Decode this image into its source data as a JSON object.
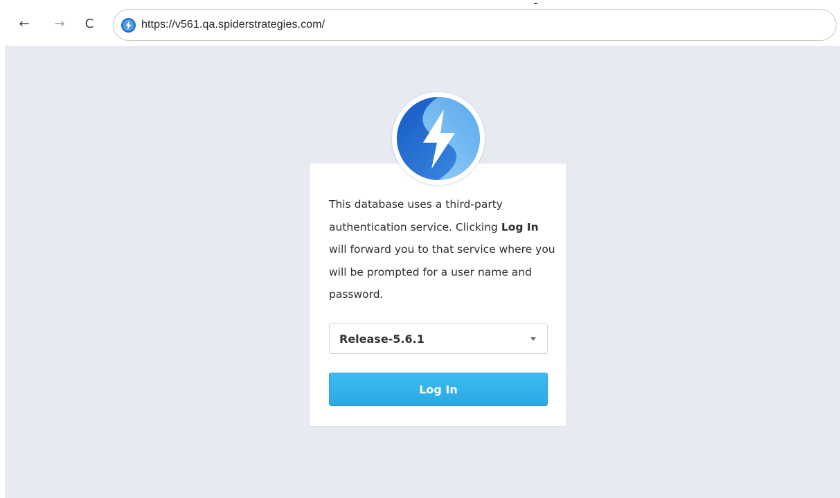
{
  "browser": {
    "back_icon": "←",
    "forward_icon": "→",
    "reload_icon": "C",
    "url": "https://v561.qa.spiderstrategies.com/"
  },
  "login": {
    "message_bold": "Log In",
    "message_before": "This database uses a third-party authentication service. Clicking",
    "message_after": "will forward you to that service where you will be prompted for a user name and password.",
    "database_select": {
      "selected": "Release-5.6.1"
    },
    "login_button_label": "Log In"
  },
  "colors": {
    "page_background": "#e7ebf1",
    "button_blue": "#33b3ee",
    "logo_blue_dark": "#1a66c9",
    "logo_blue_light": "#6bbcf2"
  }
}
